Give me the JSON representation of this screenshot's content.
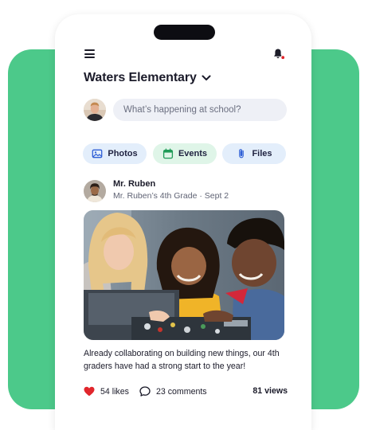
{
  "header": {
    "school_name": "Waters Elementary"
  },
  "compose": {
    "placeholder": "What’s happening at school?"
  },
  "actions": [
    {
      "label": "Photos",
      "icon": "image-icon"
    },
    {
      "label": "Events",
      "icon": "calendar-icon"
    },
    {
      "label": "Files",
      "icon": "paperclip-icon"
    }
  ],
  "post": {
    "author": "Mr. Ruben",
    "subtitle": "Mr. Ruben’s 4th Grade · Sept 2",
    "caption": "Already collaborating on building new things, our 4th graders have had a strong start to the year!",
    "likes": "54 likes",
    "comments": "23 comments",
    "views": "81 views"
  },
  "colors": {
    "accent_green": "#4cc98a",
    "like_red": "#e1262c",
    "chip_blue": "#e3eefb",
    "chip_green": "#dff5e8",
    "notification_dot": "#e1262c"
  }
}
